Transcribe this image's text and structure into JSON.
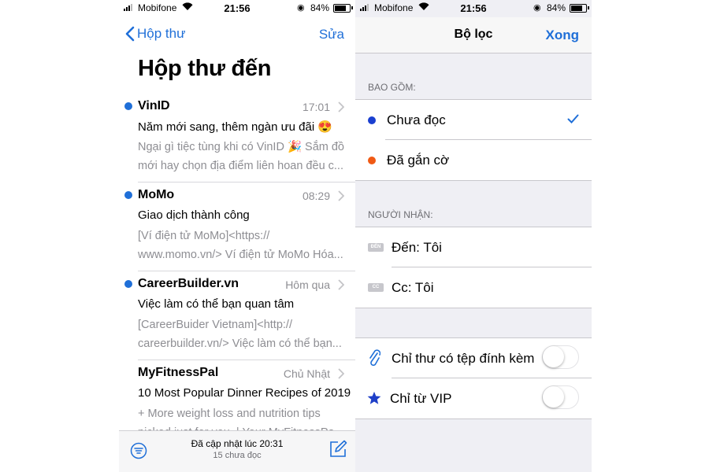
{
  "left": {
    "status": {
      "carrier": "Mobifone",
      "time": "21:56",
      "battery": "84%"
    },
    "nav": {
      "back_label": "Hộp thư",
      "edit_label": "Sửa"
    },
    "title": "Hộp thư đến",
    "messages": [
      {
        "sender": "VinID",
        "time": "17:01",
        "subject": "Năm mới sang, thêm ngàn ưu đãi 😍",
        "preview": "Ngại gì tiệc tùng khi có VinID 🎉 Sắm đồ mới hay chọn địa điểm liên hoan đều c...",
        "unread": true
      },
      {
        "sender": "MoMo",
        "time": "08:29",
        "subject": "Giao dịch thành công",
        "preview": "[Ví điện tử MoMo]<https:// www.momo.vn/> Ví điện tử MoMo Hóa...",
        "unread": true
      },
      {
        "sender": "CareerBuilder.vn",
        "time": "Hôm qua",
        "subject": "Việc làm có thể bạn quan tâm",
        "preview": "[CareerBuider Vietnam]<http:// careerbuilder.vn/> Việc làm có thể bạn...",
        "unread": true
      },
      {
        "sender": "MyFitnessPal",
        "time": "Chủ Nhật",
        "subject": "10 Most Popular Dinner Recipes of 2019",
        "preview": "+ More weight loss and nutrition tips picked just for you. | Your MyFitnessPa...",
        "unread": false
      }
    ],
    "toolbar": {
      "updated": "Đã cập nhật lúc 20:31",
      "unread_count": "15 chưa đọc"
    }
  },
  "right": {
    "status": {
      "carrier": "Mobifone",
      "time": "21:56",
      "battery": "84%"
    },
    "nav": {
      "title": "Bộ lọc",
      "done_label": "Xong"
    },
    "include_header": "BAO GỒM:",
    "include": [
      {
        "label": "Chưa đọc",
        "dot_color": "#1a3fd0",
        "checked": true
      },
      {
        "label": "Đã gắn cờ",
        "dot_color": "#f05a14",
        "checked": false
      }
    ],
    "recipient_header": "NGƯỜI NHẬN:",
    "recipients": [
      {
        "tag": "ĐẾN",
        "label": "Đến: Tôi"
      },
      {
        "tag": "CC",
        "label": "Cc: Tôi"
      }
    ],
    "options": [
      {
        "label": "Chỉ thư có tệp đính kèm",
        "icon": "paperclip-icon",
        "on": false
      },
      {
        "label": "Chỉ từ VIP",
        "icon": "star-icon",
        "on": false
      }
    ]
  }
}
